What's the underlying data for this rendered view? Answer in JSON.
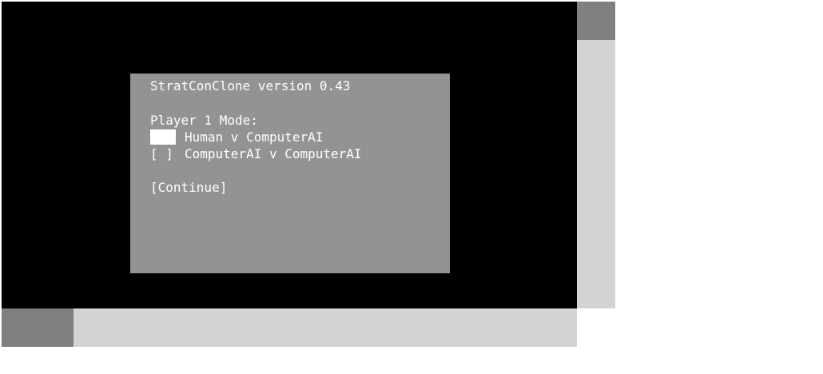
{
  "dialog": {
    "title": "StratConClone version 0.43",
    "mode_label": "Player 1 Mode:",
    "options": [
      {
        "marker": "",
        "label": "Human v ComputerAI",
        "selected": true
      },
      {
        "marker": "[ ]",
        "label": "ComputerAI v ComputerAI",
        "selected": false
      }
    ],
    "continue_label": "[Continue]"
  },
  "colors": {
    "viewport": "#000000",
    "dialog": "#939393",
    "text": "#ffffff",
    "scroll_track": "#d3d3d3",
    "scroll_thumb": "#808080"
  }
}
